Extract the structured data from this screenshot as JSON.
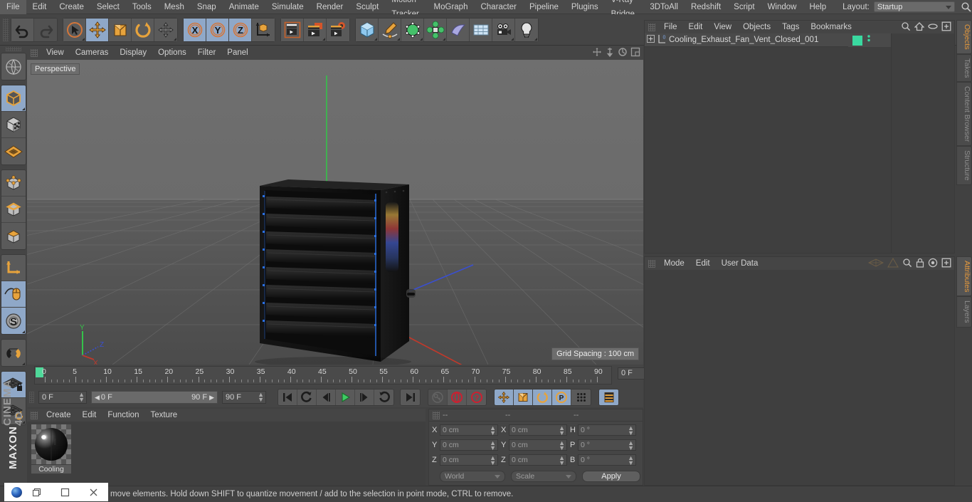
{
  "menubar": {
    "items": [
      "File",
      "Edit",
      "Create",
      "Select",
      "Tools",
      "Mesh",
      "Snap",
      "Animate",
      "Simulate",
      "Render",
      "Sculpt",
      "Motion Tracker",
      "MoGraph",
      "Character",
      "Pipeline",
      "Plugins",
      "V-Ray Bridge",
      "3DToAll",
      "Redshift",
      "Script",
      "Window",
      "Help"
    ],
    "layout_label": "Layout:",
    "layout_value": "Startup",
    "search_icon": "search-icon"
  },
  "toolbar": {
    "groups": [
      {
        "name": "undo-redo",
        "buttons": [
          {
            "icon": "undo-icon",
            "label": "Undo",
            "state": "normal"
          },
          {
            "icon": "redo-icon",
            "label": "Redo",
            "state": "disabled"
          }
        ]
      },
      {
        "name": "transform-tools",
        "buttons": [
          {
            "icon": "live-selection-icon",
            "label": "Live Selection",
            "state": "normal"
          },
          {
            "icon": "move-icon",
            "label": "Move",
            "state": "selected"
          },
          {
            "icon": "scale-icon",
            "label": "Scale",
            "state": "normal"
          },
          {
            "icon": "rotate-icon",
            "label": "Rotate",
            "state": "normal"
          },
          {
            "icon": "move-dynamic-icon",
            "label": "Move Dynamic",
            "state": "normal"
          }
        ]
      },
      {
        "name": "axis-locks",
        "buttons": [
          {
            "icon": "x-axis-icon",
            "label": "X",
            "state": "selected"
          },
          {
            "icon": "y-axis-icon",
            "label": "Y",
            "state": "selected"
          },
          {
            "icon": "z-axis-icon",
            "label": "Z",
            "state": "selected"
          },
          {
            "icon": "world-object-axis-icon",
            "label": "World/Object",
            "state": "normal"
          }
        ]
      },
      {
        "name": "render-tools",
        "buttons": [
          {
            "icon": "render-view-icon",
            "label": "Render View",
            "state": "normal"
          },
          {
            "icon": "render-region-icon",
            "label": "Render to Picture Viewer",
            "state": "normal"
          },
          {
            "icon": "render-settings-icon",
            "label": "Render Settings",
            "state": "normal"
          }
        ]
      },
      {
        "name": "object-create",
        "buttons": [
          {
            "icon": "cube-primitive-icon",
            "label": "Add Cube Object",
            "state": "normal"
          },
          {
            "icon": "spline-pen-icon",
            "label": "Add Spline",
            "state": "normal"
          },
          {
            "icon": "generator-icon",
            "label": "Add Generator",
            "state": "normal"
          },
          {
            "icon": "deformer-icon",
            "label": "Add Deformer",
            "state": "normal"
          },
          {
            "icon": "environment-icon",
            "label": "Add Scene Object",
            "state": "normal"
          },
          {
            "icon": "floor-grid-icon",
            "label": "Add Floor",
            "state": "normal"
          },
          {
            "icon": "camera-icon",
            "label": "Add Camera",
            "state": "normal"
          },
          {
            "icon": "light-bulb-icon",
            "label": "Add Light",
            "state": "normal"
          }
        ]
      }
    ]
  },
  "left_toolbar": {
    "buttons": [
      {
        "icon": "make-editable-icon",
        "label": "Make Editable",
        "state": "normal"
      },
      {
        "icon": "model-mode-icon",
        "label": "Model Mode",
        "state": "selected"
      },
      {
        "icon": "texture-mode-icon",
        "label": "Texture Mode",
        "state": "normal"
      },
      {
        "icon": "workplane-icon",
        "label": "Workplane",
        "state": "normal"
      },
      {
        "icon": "points-mode-icon",
        "label": "Points",
        "state": "normal"
      },
      {
        "icon": "edges-mode-icon",
        "label": "Edges",
        "state": "normal"
      },
      {
        "icon": "polygons-mode-icon",
        "label": "Polygons",
        "state": "normal"
      },
      {
        "icon": "axis-modify-icon",
        "label": "Enable Axis Modification",
        "state": "normal"
      },
      {
        "icon": "viewport-solo-icon",
        "label": "Viewport Solo Single",
        "state": "selected"
      },
      {
        "icon": "soft-selection-icon",
        "label": "Enable Soft Selection",
        "state": "selected"
      },
      {
        "icon": "snap-magnet-icon",
        "label": "Enable Snapping",
        "state": "normal"
      },
      {
        "icon": "workplane-lock-icon",
        "label": "Lock Workplane",
        "state": "selected"
      },
      {
        "icon": "workplane-reset-icon",
        "label": "Planar Workplane Mode",
        "state": "normal"
      }
    ],
    "brand_top": "MAXON",
    "brand_bottom": "CINEMA 4D"
  },
  "viewport": {
    "menu": [
      "View",
      "Cameras",
      "Display",
      "Options",
      "Filter",
      "Panel"
    ],
    "camera_label": "Perspective",
    "grid_spacing": "Grid Spacing : 100 cm",
    "axis_labels": {
      "x": "X",
      "y": "Y",
      "z": "Z"
    },
    "corner_icons": [
      "pan-icon",
      "dolly-icon",
      "rotate-view-icon",
      "maximize-view-icon"
    ]
  },
  "timeline": {
    "ticks": [
      "0",
      "5",
      "10",
      "15",
      "20",
      "25",
      "30",
      "35",
      "40",
      "45",
      "50",
      "55",
      "60",
      "65",
      "70",
      "75",
      "80",
      "85",
      "90"
    ],
    "current_frame_field": "0 F"
  },
  "transport": {
    "current_frame": "0 F",
    "range_start": "0 F",
    "range_end": "90 F",
    "preview_end": "90 F",
    "buttons": [
      {
        "icon": "go-to-start-icon",
        "label": "Go to Start",
        "state": "normal"
      },
      {
        "icon": "previous-key-icon",
        "label": "Go to Previous Key",
        "state": "normal"
      },
      {
        "icon": "step-back-icon",
        "label": "Go to Previous Frame",
        "state": "normal"
      },
      {
        "icon": "play-icon",
        "label": "Play Forwards",
        "state": "normal"
      },
      {
        "icon": "step-forward-icon",
        "label": "Go to Next Frame",
        "state": "normal"
      },
      {
        "icon": "next-key-icon",
        "label": "Go to Next Key",
        "state": "normal"
      },
      {
        "icon": "go-to-end-icon",
        "label": "Go to End",
        "state": "normal"
      },
      {
        "icon": "autokey-key-icon",
        "label": "Record Active Objects",
        "state": "disabled"
      },
      {
        "icon": "autokeying-icon",
        "label": "Autokeying",
        "state": "normal"
      },
      {
        "icon": "keyframe-selection-icon",
        "label": "Keyframe Selection",
        "state": "normal"
      },
      {
        "icon": "record-position-icon",
        "label": "Position",
        "state": "selected"
      },
      {
        "icon": "record-scale-icon",
        "label": "Scale",
        "state": "selected"
      },
      {
        "icon": "record-rotation-icon",
        "label": "Rotation",
        "state": "selected"
      },
      {
        "icon": "record-pla-icon",
        "label": "Point Level Animation",
        "state": "selected"
      },
      {
        "icon": "dots-grid-icon",
        "label": "Parameter",
        "state": "normal"
      },
      {
        "icon": "timeline-toggle-icon",
        "label": "Animation Layers",
        "state": "selected"
      }
    ]
  },
  "material_manager": {
    "menu": [
      "Create",
      "Edit",
      "Function",
      "Texture"
    ],
    "materials": [
      {
        "name": "Cooling",
        "thumb": "sphere-preview"
      }
    ]
  },
  "coordinate_manager": {
    "headers": [
      "--",
      "--",
      "--"
    ],
    "rows": [
      {
        "pos_label": "X",
        "pos_value": "0 cm",
        "size_label": "X",
        "size_value": "0 cm",
        "rot_label": "H",
        "rot_value": "0 °"
      },
      {
        "pos_label": "Y",
        "pos_value": "0 cm",
        "size_label": "Y",
        "size_value": "0 cm",
        "rot_label": "P",
        "rot_value": "0 °"
      },
      {
        "pos_label": "Z",
        "pos_value": "0 cm",
        "size_label": "Z",
        "size_value": "0 cm",
        "rot_label": "B",
        "rot_value": "0 °"
      }
    ],
    "system": "World",
    "mode": "Scale",
    "apply": "Apply"
  },
  "object_manager": {
    "menu": [
      "File",
      "Edit",
      "View",
      "Objects",
      "Tags",
      "Bookmarks"
    ],
    "icons": [
      "search-icon",
      "home-icon",
      "ellipse-icon",
      "expand-icon"
    ],
    "objects": [
      {
        "name": "Cooling_Exhaust_Fan_Vent_Closed_001",
        "layer_badge": "0",
        "tag_color": "#3ad9a0",
        "expandable": true
      }
    ]
  },
  "attribute_manager": {
    "menu": [
      "Mode",
      "Edit",
      "User Data"
    ],
    "icons": [
      "nurbs-icon",
      "triangle-icon",
      "search-icon",
      "lock-icon",
      "target-icon",
      "expand-icon"
    ]
  },
  "right_tabs": {
    "top": [
      {
        "label": "Objects",
        "active": true
      },
      {
        "label": "Takes",
        "active": false
      },
      {
        "label": "Content Browser",
        "active": false
      },
      {
        "label": "Structure",
        "active": false
      }
    ],
    "bottom": [
      {
        "label": "Attributes",
        "active": true
      },
      {
        "label": "Layers",
        "active": false
      }
    ]
  },
  "status_bar": {
    "text": "move elements. Hold down SHIFT to quantize movement / add to the selection in point mode, CTRL to remove."
  },
  "mini_window": {
    "icon": "app-orb-icon",
    "buttons": [
      "restore-icon",
      "maximize-icon",
      "close-icon"
    ]
  },
  "colors": {
    "accent_orange": "#e89a3c",
    "selected_blue": "#8fa8c8",
    "panel_bg": "#454545",
    "tag_green": "#3ad9a0"
  }
}
